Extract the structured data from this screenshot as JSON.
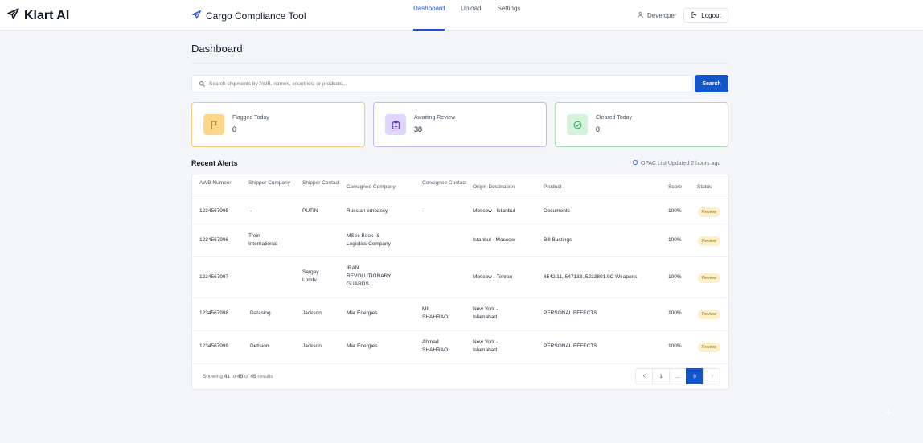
{
  "brand": {
    "name": "Klart AI"
  },
  "app": {
    "title": "Cargo Compliance Tool"
  },
  "nav": {
    "tabs": [
      "Dashboard",
      "Upload",
      "Settings"
    ],
    "active": "Dashboard"
  },
  "user": {
    "name": "Developer",
    "logout_label": "Logout"
  },
  "page": {
    "title": "Dashboard"
  },
  "search": {
    "placeholder": "Search shipments by AWB, names, countries, or products...",
    "button_label": "Search"
  },
  "stats": {
    "flagged": {
      "label": "Flagged Today",
      "value": "0"
    },
    "awaiting": {
      "label": "Awaiting Review",
      "value": "38"
    },
    "cleared": {
      "label": "Cleared Today",
      "value": "0"
    }
  },
  "alerts": {
    "title": "Recent Alerts",
    "ofac_status": "OFAC List Updated 2 hours ago",
    "columns": [
      "AWB\nNumber",
      "Shipper\nCompany",
      "Shipper\nContact",
      "Consignee Company",
      "Consignee\nContact",
      "Origin-Destination",
      "Product",
      "Score",
      "Status"
    ],
    "rows": [
      {
        "awb": "1234567995",
        "shipper_company": "-",
        "shipper_contact": "PUTIN",
        "consignee_company": "Russian embassy",
        "consignee_contact": "-",
        "route": "Moscow - Istanbul",
        "product": "Documents",
        "score": "100%",
        "status": "Review"
      },
      {
        "awb": "1234567996",
        "shipper_company": "Trein\nInternational",
        "shipper_contact": "",
        "consignee_company": "MSec Book- &\nLogistics Company",
        "consignee_contact": "",
        "route": "Istanbul - Moscow",
        "product": "Bill Bustings",
        "score": "100%",
        "status": "Review"
      },
      {
        "awb": "1234567997",
        "shipper_company": "",
        "shipper_contact": "Sergey\nLomtv",
        "consignee_company": "IRAN\nREVOLUTIONARY\nGUARDS",
        "consignee_contact": "",
        "route": "Moscow - Tehran",
        "product": "8542.11, 547133, 5233801.9C Weapons",
        "score": "100%",
        "status": "Review"
      },
      {
        "awb": "1234567998",
        "shipper_company": "Datasiog",
        "shipper_contact": "Jackson",
        "consignee_company": "Mar Energies",
        "consignee_contact": "MIL\nSHAHRAO",
        "route": "New York -\nIslamabad",
        "product": "PERSONAL EFFECTS",
        "score": "100%",
        "status": "Review"
      },
      {
        "awb": "1234567999",
        "shipper_company": "Detision",
        "shipper_contact": "Jackson",
        "consignee_company": "Mar Energies",
        "consignee_contact": "Ahmad\nSHAHRAO",
        "route": "New York -\nIslamabad",
        "product": "PERSONAL EFFECTS",
        "score": "100%",
        "status": "Review"
      }
    ]
  },
  "pagination": {
    "summary_prefix": "Showing",
    "from": "41",
    "to_word": "to",
    "to": "45",
    "of_word": "of",
    "total": "45",
    "unit": "results",
    "pages": [
      "1",
      "...",
      "9"
    ],
    "current": "9"
  },
  "icons": {
    "brand": "plane-icon",
    "app": "plane-icon",
    "user": "user-icon",
    "logout": "logout-icon",
    "search": "search-icon",
    "flagged": "flag-icon",
    "awaiting": "clipboard-icon",
    "cleared": "check-circle-icon",
    "refresh": "refresh-icon"
  },
  "colors": {
    "accent": "#1456c7",
    "flagged_border": "#f6c97a",
    "awaiting_border": "#c4b5fd",
    "cleared_border": "#a7e0b2",
    "review_badge_bg": "#fbf0c9"
  }
}
